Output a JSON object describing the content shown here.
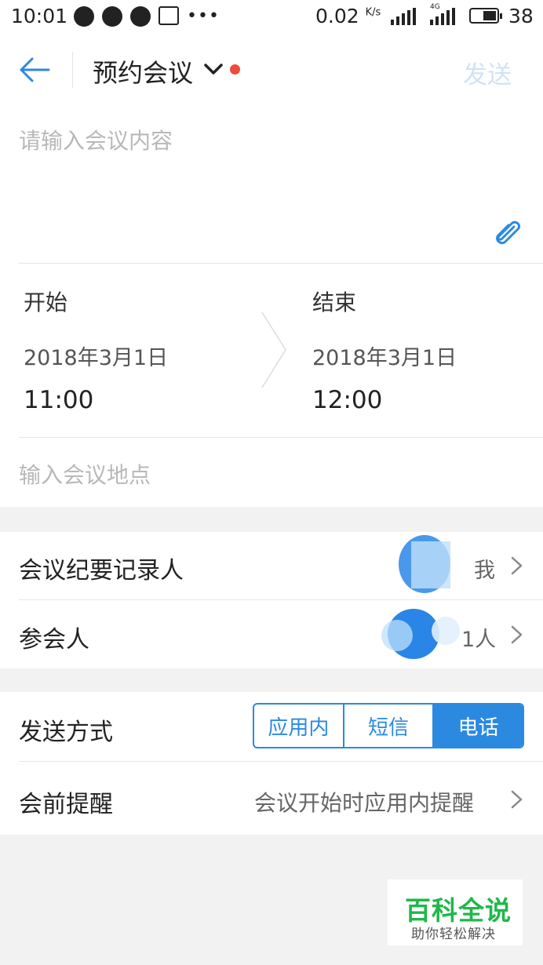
{
  "status_bar": {
    "time": "10:01",
    "speed": "0.02",
    "speed_unit": "K/s",
    "network": "4G",
    "battery": "38"
  },
  "header": {
    "title": "预约会议",
    "send_label": "发送"
  },
  "content": {
    "placeholder": "请输入会议内容"
  },
  "schedule": {
    "start_label": "开始",
    "start_date": "2018年3月1日",
    "start_time": "11:00",
    "end_label": "结束",
    "end_date": "2018年3月1日",
    "end_time": "12:00"
  },
  "location": {
    "placeholder": "输入会议地点"
  },
  "recorder": {
    "label": "会议纪要记录人",
    "value": "我"
  },
  "participants": {
    "label": "参会人",
    "value": "1人"
  },
  "send_method": {
    "label": "发送方式",
    "options": [
      "应用内",
      "短信",
      "电话"
    ],
    "selected": "电话"
  },
  "reminder": {
    "label": "会前提醒",
    "value": "会议开始时应用内提醒"
  },
  "watermark": {
    "title": "百科全说",
    "subtitle": "助你轻松解决"
  },
  "colors": {
    "accent": "#2b8ae0",
    "alert_dot": "#f04b3a",
    "send_disabled": "#cfe3f6"
  }
}
